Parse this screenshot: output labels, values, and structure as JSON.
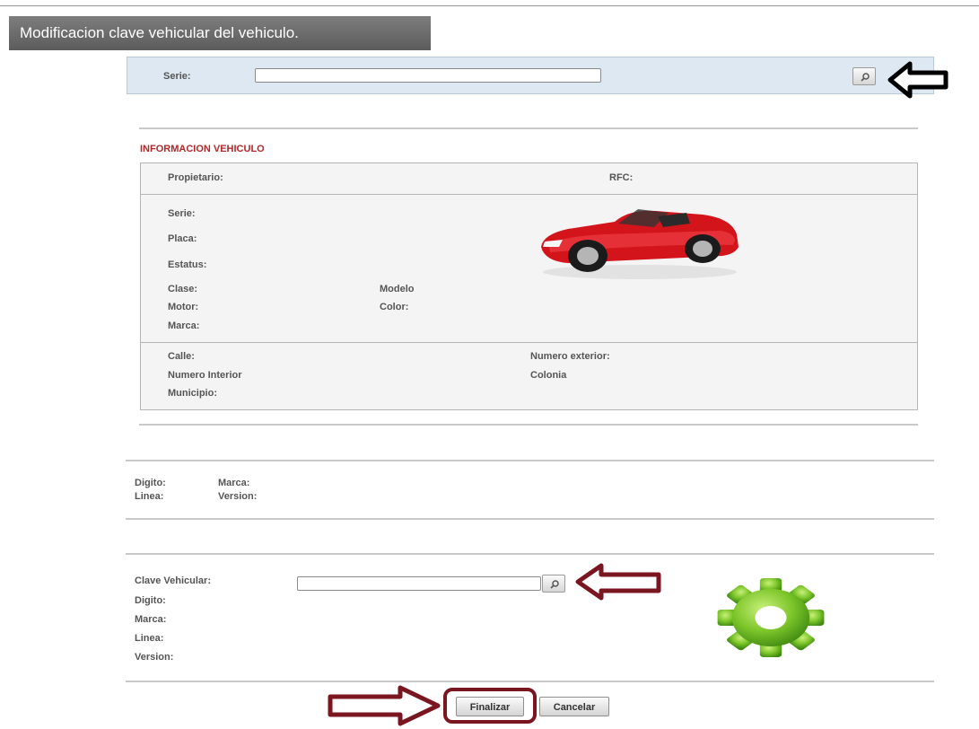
{
  "page_title": "Modificacion clave vehicular del vehiculo.",
  "search": {
    "serie_label": "Serie:",
    "serie_value": ""
  },
  "vehicle_info": {
    "section_title": "INFORMACION VEHICULO",
    "propietario_label": "Propietario:",
    "rfc_label": "RFC:",
    "serie_label": "Serie:",
    "placa_label": "Placa:",
    "estatus_label": "Estatus:",
    "clase_label": "Clase:",
    "modelo_label": "Modelo",
    "motor_label": "Motor:",
    "color_label": "Color:",
    "marca_label": "Marca:",
    "calle_label": "Calle:",
    "numero_exterior_label": "Numero exterior:",
    "numero_interior_label": "Numero Interior",
    "colonia_label": "Colonia",
    "municipio_label": "Municipio:"
  },
  "current_key": {
    "digito_label": "Digito:",
    "marca_label": "Marca:",
    "linea_label": "Linea:",
    "version_label": "Version:"
  },
  "new_key": {
    "clave_label": "Clave Vehicular:",
    "clave_value": "",
    "digito_label": "Digito:",
    "marca_label": "Marca:",
    "linea_label": "Linea:",
    "version_label": "Version:"
  },
  "buttons": {
    "finalizar": "Finalizar",
    "cancelar": "Cancelar"
  },
  "icons": {
    "search": "magnifier-icon",
    "car": "red-convertible-car-icon",
    "gear": "green-gear-icon",
    "arrows": "pointer-arrow-icon"
  },
  "colors": {
    "section_title": "#b0282a",
    "arrow_dark": "#7a1620",
    "panel_blue": "#dde8f3",
    "gear_green": "#7cc52a",
    "car_red": "#d4141b"
  }
}
